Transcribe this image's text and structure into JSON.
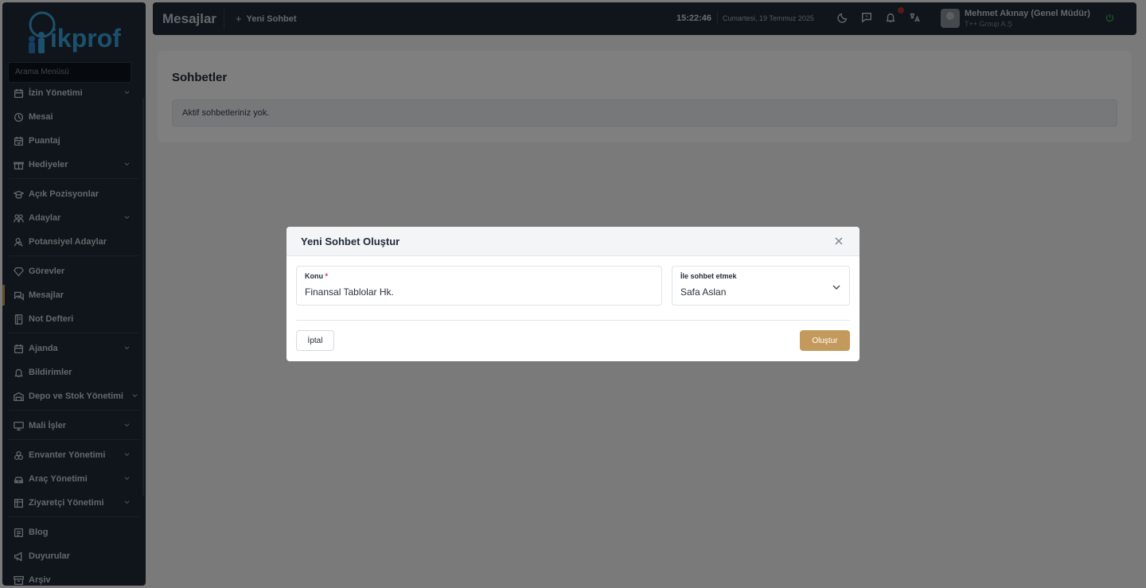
{
  "sidebar": {
    "search_placeholder": "Arama Menüsü",
    "items": [
      {
        "label": "İzin Yönetimi",
        "icon": "calendar-icon",
        "has_children": true
      },
      {
        "label": "Mesai",
        "icon": "clock-icon",
        "has_children": false
      },
      {
        "label": "Puantaj",
        "icon": "calendar-check-icon",
        "has_children": false
      },
      {
        "label": "Hediyeler",
        "icon": "gift-icon",
        "has_children": true
      },
      {
        "label": "Açık Pozisyonlar",
        "icon": "graduation-cap-icon",
        "has_children": false
      },
      {
        "label": "Adaylar",
        "icon": "users-icon",
        "has_children": true
      },
      {
        "label": "Potansiyel Adaylar",
        "icon": "user-search-icon",
        "has_children": false
      },
      {
        "label": "Görevler",
        "icon": "diamond-icon",
        "has_children": false
      },
      {
        "label": "Mesajlar",
        "icon": "messages-icon",
        "has_children": false,
        "active": true
      },
      {
        "label": "Not Defteri",
        "icon": "notebook-icon",
        "has_children": false
      },
      {
        "label": "Ajanda",
        "icon": "calendar-icon",
        "has_children": true
      },
      {
        "label": "Bildirimler",
        "icon": "bell-icon",
        "has_children": false
      },
      {
        "label": "Depo ve Stok Yönetimi",
        "icon": "warehouse-icon",
        "has_children": true
      },
      {
        "label": "Mali İşler",
        "icon": "monitor-icon",
        "has_children": true
      },
      {
        "label": "Envanter Yönetimi",
        "icon": "boxes-icon",
        "has_children": true
      },
      {
        "label": "Araç Yönetimi",
        "icon": "car-icon",
        "has_children": true
      },
      {
        "label": "Ziyaretçi Yönetimi",
        "icon": "table-icon",
        "has_children": true
      },
      {
        "label": "Blog",
        "icon": "document-icon",
        "has_children": false
      },
      {
        "label": "Duyurular",
        "icon": "megaphone-icon",
        "has_children": false
      },
      {
        "label": "Arşiv",
        "icon": "archive-icon",
        "has_children": false
      }
    ]
  },
  "topbar": {
    "page_title": "Mesajlar",
    "new_chat_label": "Yeni Sohbet",
    "time": "15:22:46",
    "date": "Cumartesi, 19 Temmuz 2025",
    "user_name": "Mehmet Akınay (Genel Müdür)",
    "user_company": "T++ Group A.Ş"
  },
  "main": {
    "card_title": "Sohbetler",
    "empty_message": "Aktif sohbetleriniz yok."
  },
  "modal": {
    "title": "Yeni Sohbet Oluştur",
    "subject_label": "Konu",
    "subject_required_mark": "*",
    "subject_value": "Finansal Tablolar Hk.",
    "chat_with_label": "İle sohbet etmek",
    "chat_with_value": "Safa Aslan",
    "cancel_label": "İptal",
    "create_label": "Oluştur"
  },
  "colors": {
    "sidebar_bg": "#1f2a36",
    "accent": "#c49a5c",
    "required": "#d2333f",
    "notification_dot": "#b23333",
    "online": "#2e9e4d"
  }
}
